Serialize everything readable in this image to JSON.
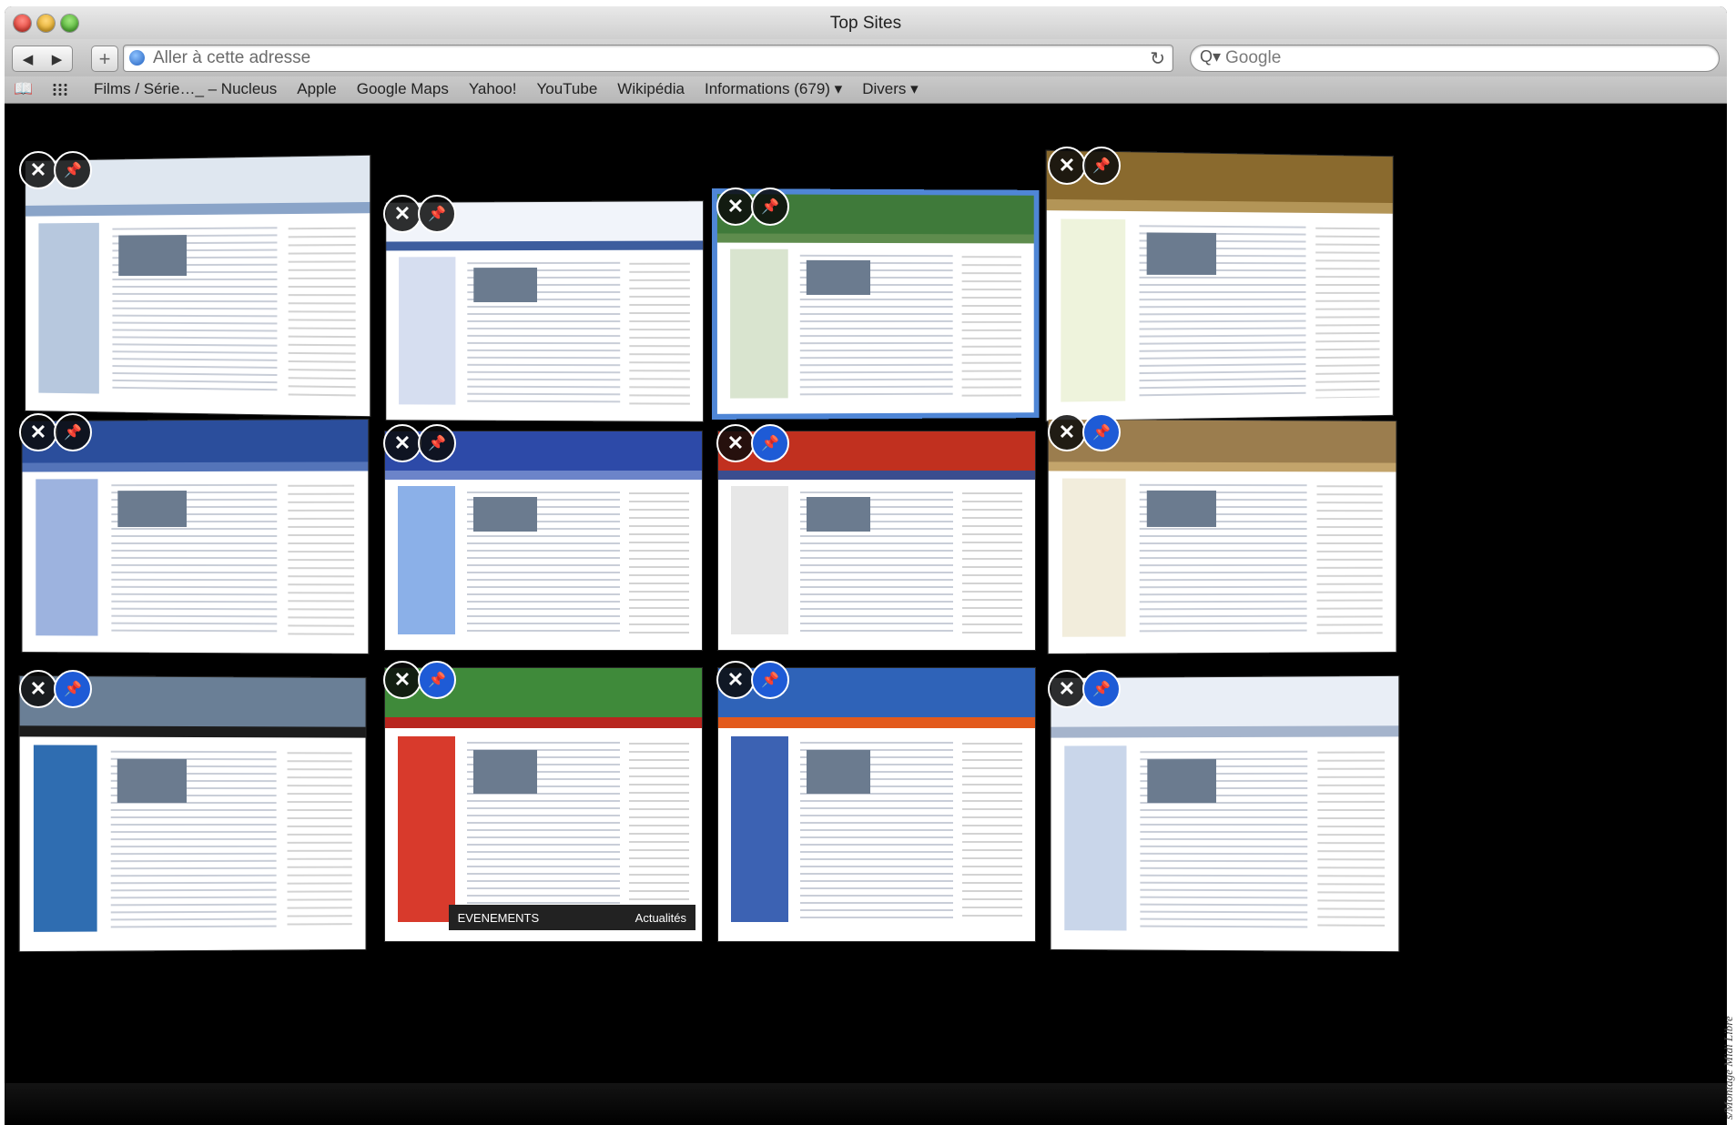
{
  "window": {
    "title": "Top Sites"
  },
  "toolbar": {
    "back_label": "◀",
    "forward_label": "▶",
    "add_label": "+",
    "address_placeholder": "Aller à cette adresse",
    "reload_label": "↻",
    "search_placeholder": "Google",
    "search_icon": "Q▾"
  },
  "bookmarks": {
    "items": [
      "Films / Série…_ – Nucleus",
      "Apple",
      "Google Maps",
      "Yahoo!",
      "YouTube",
      "Wikipédia",
      "Informations (679) ▾",
      "Divers ▾"
    ]
  },
  "tiles": {
    "close_label": "✕",
    "pin_label": "📌",
    "sites": [
      {
        "header": "#dfe7f0",
        "nav": "#8aa4c8",
        "side": "#b7c8de",
        "pinned": false
      },
      {
        "header": "#f1f4fa",
        "nav": "#3d5d9e",
        "side": "#d6def0",
        "pinned": false
      },
      {
        "header": "#3f7a3a",
        "nav": "#5e8c4d",
        "side": "#d9e4cf",
        "pinned": false
      },
      {
        "header": "#8a6a2e",
        "nav": "#b39557",
        "side": "#eef3dc",
        "pinned": false
      },
      {
        "header": "#2b4e9c",
        "nav": "#5474b9",
        "side": "#9db3df",
        "pinned": false
      },
      {
        "header": "#2d4aa8",
        "nav": "#6c84c9",
        "side": "#8bb0e8",
        "pinned": false
      },
      {
        "header": "#c1301f",
        "nav": "#3a4d8f",
        "side": "#e7e7e7",
        "pinned": true
      },
      {
        "header": "#9b7d4e",
        "nav": "#c3a46b",
        "side": "#f2eddc",
        "pinned": true
      },
      {
        "header": "#6a7f96",
        "nav": "#1c1c1c",
        "side": "#2f6db1",
        "pinned": true
      },
      {
        "header": "#3f8a3a",
        "nav": "#b8261f",
        "side": "#d83a2c",
        "pinned": true
      },
      {
        "header": "#2f63b8",
        "nav": "#e35a1c",
        "side": "#3c62b3",
        "pinned": true
      },
      {
        "header": "#e9eef6",
        "nav": "#a5b4cc",
        "side": "#c9d6ea",
        "pinned": true
      }
    ]
  },
  "evenements_label": "EVENEMENTS",
  "actualites_label": "Actualités",
  "credit": "s/Montage Midi Libre"
}
